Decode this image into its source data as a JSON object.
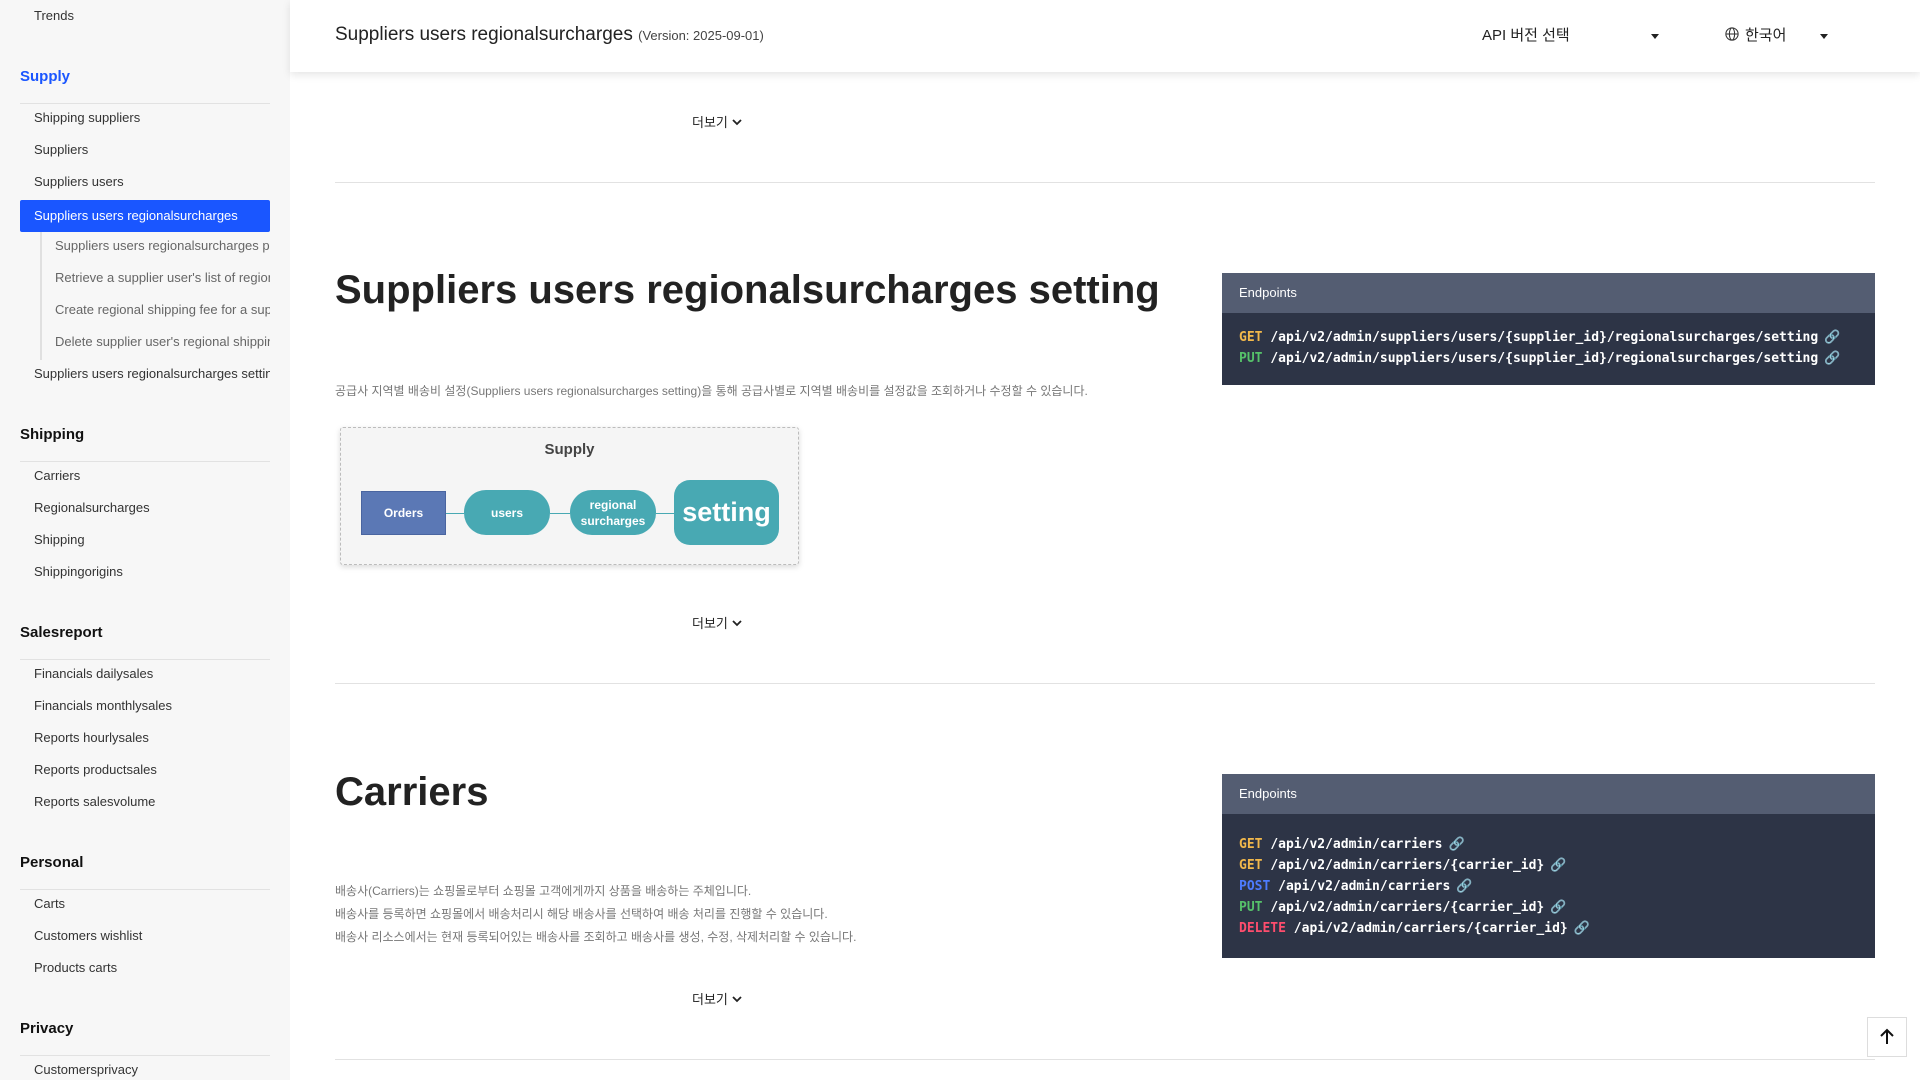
{
  "sidebar": {
    "top_item": "Trends",
    "groups": [
      {
        "title": "Supply",
        "items": [
          {
            "label": "Shipping suppliers"
          },
          {
            "label": "Suppliers"
          },
          {
            "label": "Suppliers users"
          },
          {
            "label": "Suppliers users regionalsurcharges"
          }
        ],
        "subitems": [
          {
            "label": "Suppliers users regionalsurcharges properties"
          },
          {
            "label": "Retrieve a supplier user's list of regional shipping fees"
          },
          {
            "label": "Create regional shipping fee for a supplier user"
          },
          {
            "label": "Delete supplier user's regional shipping fee"
          }
        ],
        "after": "Suppliers users regionalsurcharges setting"
      },
      {
        "title": "Shipping",
        "items": [
          {
            "label": "Carriers"
          },
          {
            "label": "Regionalsurcharges"
          },
          {
            "label": "Shipping"
          },
          {
            "label": "Shippingorigins"
          }
        ]
      },
      {
        "title": "Salesreport",
        "items": [
          {
            "label": "Financials dailysales"
          },
          {
            "label": "Financials monthlysales"
          },
          {
            "label": "Reports hourlysales"
          },
          {
            "label": "Reports productsales"
          },
          {
            "label": "Reports salesvolume"
          }
        ]
      },
      {
        "title": "Personal",
        "items": [
          {
            "label": "Carts"
          },
          {
            "label": "Customers wishlist"
          },
          {
            "label": "Products carts"
          }
        ]
      },
      {
        "title": "Privacy",
        "items": [
          {
            "label": "Customersprivacy"
          }
        ]
      }
    ]
  },
  "header": {
    "title": "Suppliers users regionalsurcharges",
    "version": "(Version: 2025-09-01)",
    "api_version_select": "API 버전 선택",
    "language_select": "한국어"
  },
  "more_label": "더보기",
  "sections": [
    {
      "title": "Suppliers users regionalsurcharges setting",
      "description": [
        "공급사 지역별 배송비 설정(Suppliers users regionalsurcharges setting)을 통해 공급사별로 지역별 배송비를 설정값을 조회하거나 수정할 수 있습니다."
      ],
      "endpoints_title": "Endpoints",
      "endpoints": [
        {
          "method": "GET",
          "path": "/api/v2/admin/suppliers/users/{supplier_id}/regionalsurcharges/setting"
        },
        {
          "method": "PUT",
          "path": "/api/v2/admin/suppliers/users/{supplier_id}/regionalsurcharges/setting"
        }
      ],
      "diagram": {
        "title": "Supply",
        "nodes": [
          "Orders",
          "users",
          "regional surcharges",
          "setting"
        ]
      }
    },
    {
      "title": "Carriers",
      "description": [
        "배송사(Carriers)는 쇼핑몰로부터 쇼핑몰 고객에게까지 상품을 배송하는 주체입니다.",
        "배송사를 등록하면 쇼핑몰에서 배송처리시 해당 배송사를 선택하여 배송 처리를 진행할 수 있습니다.",
        "배송사 리소스에서는 현재 등록되어있는 배송사를 조회하고 배송사를 생성, 수정, 삭제처리할 수 있습니다."
      ],
      "endpoints_title": "Endpoints",
      "endpoints": [
        {
          "method": "GET",
          "path": "/api/v2/admin/carriers"
        },
        {
          "method": "GET",
          "path": "/api/v2/admin/carriers/{carrier_id}"
        },
        {
          "method": "POST",
          "path": "/api/v2/admin/carriers"
        },
        {
          "method": "PUT",
          "path": "/api/v2/admin/carriers/{carrier_id}"
        },
        {
          "method": "DELETE",
          "path": "/api/v2/admin/carriers/{carrier_id}"
        }
      ]
    }
  ],
  "colors": {
    "accent": "#1a56ff",
    "endpoint_bg": "#2d3446",
    "endpoint_head": "#545d72",
    "get": "#f2b84b",
    "put": "#56c26a",
    "post": "#4d7cff",
    "delete": "#ff4d6d",
    "diagram_node": "#48a9b3",
    "diagram_orders": "#5b78b5"
  }
}
